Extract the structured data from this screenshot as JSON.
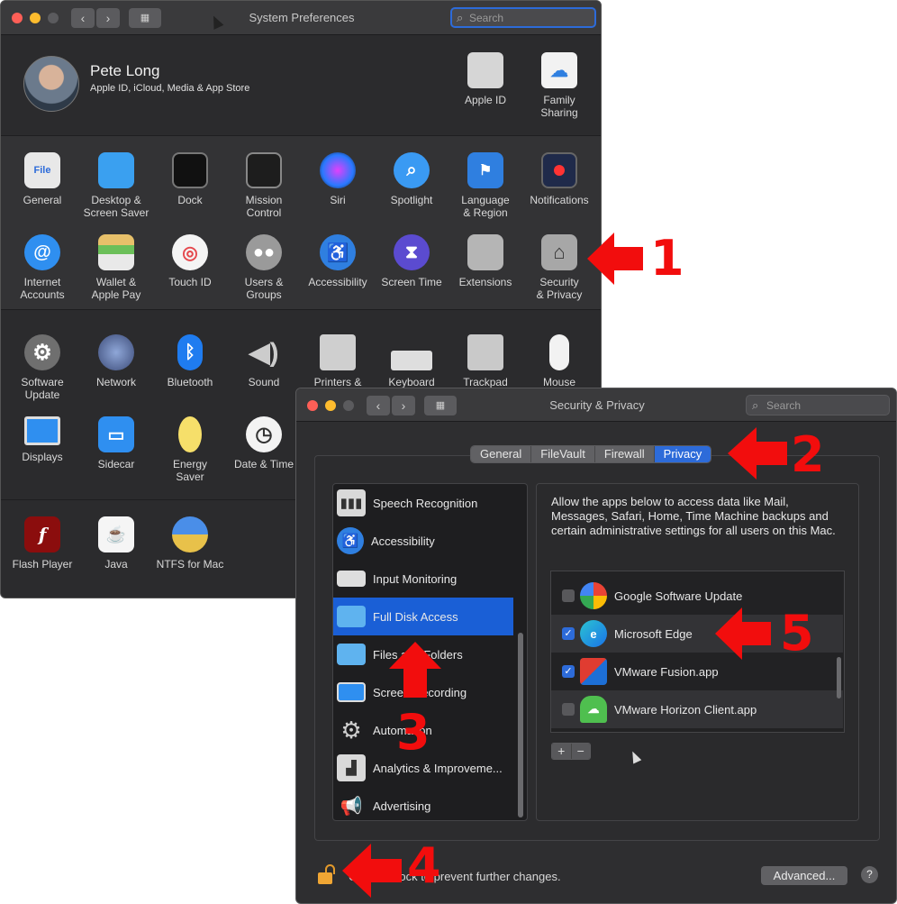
{
  "sysprefs": {
    "title": "System Preferences",
    "search_placeholder": "Search",
    "user": {
      "name": "Pete Long",
      "subtitle": "Apple ID, iCloud, Media & App Store"
    },
    "account_items": [
      {
        "label": "Apple ID",
        "icon": "apple-icon"
      },
      {
        "label": "Family\nSharing",
        "icon": "family-icon"
      }
    ],
    "rows": [
      [
        {
          "label": "General",
          "icon": "general-icon"
        },
        {
          "label": "Desktop &\nScreen Saver",
          "icon": "desktop-icon"
        },
        {
          "label": "Dock",
          "icon": "dock-icon"
        },
        {
          "label": "Mission\nControl",
          "icon": "mission-control-icon"
        },
        {
          "label": "Siri",
          "icon": "siri-icon"
        },
        {
          "label": "Spotlight",
          "icon": "spotlight-icon"
        },
        {
          "label": "Language\n& Region",
          "icon": "flag-icon"
        },
        {
          "label": "Notifications",
          "icon": "notifications-icon"
        }
      ],
      [
        {
          "label": "Internet\nAccounts",
          "icon": "at-icon"
        },
        {
          "label": "Wallet &\nApple Pay",
          "icon": "wallet-icon"
        },
        {
          "label": "Touch ID",
          "icon": "fingerprint-icon"
        },
        {
          "label": "Users &\nGroups",
          "icon": "users-icon"
        },
        {
          "label": "Accessibility",
          "icon": "accessibility-icon"
        },
        {
          "label": "Screen Time",
          "icon": "hourglass-icon"
        },
        {
          "label": "Extensions",
          "icon": "puzzle-icon"
        },
        {
          "label": "Security\n& Privacy",
          "icon": "house-lock-icon"
        }
      ],
      [
        {
          "label": "Software\nUpdate",
          "icon": "gear-icon"
        },
        {
          "label": "Network",
          "icon": "globe-icon"
        },
        {
          "label": "Bluetooth",
          "icon": "bluetooth-icon"
        },
        {
          "label": "Sound",
          "icon": "speaker-icon"
        },
        {
          "label": "Printers &",
          "icon": "printer-icon"
        },
        {
          "label": "Keyboard",
          "icon": "keyboard-icon"
        },
        {
          "label": "Trackpad",
          "icon": "trackpad-icon"
        },
        {
          "label": "Mouse",
          "icon": "mouse-icon"
        }
      ],
      [
        {
          "label": "Displays",
          "icon": "display-icon"
        },
        {
          "label": "Sidecar",
          "icon": "sidecar-icon"
        },
        {
          "label": "Energy\nSaver",
          "icon": "bulb-icon"
        },
        {
          "label": "Date & Time",
          "icon": "clock-icon"
        }
      ],
      [
        {
          "label": "Flash Player",
          "icon": "flash-icon"
        },
        {
          "label": "Java",
          "icon": "java-icon"
        },
        {
          "label": "NTFS for Mac",
          "icon": "ntfs-icon"
        }
      ]
    ]
  },
  "security": {
    "title": "Security & Privacy",
    "search_placeholder": "Search",
    "tabs": [
      "General",
      "FileVault",
      "Firewall",
      "Privacy"
    ],
    "active_tab": "Privacy",
    "categories": [
      {
        "label": "Speech Recognition",
        "icon": "waveform-icon"
      },
      {
        "label": "Accessibility",
        "icon": "accessibility-icon"
      },
      {
        "label": "Input Monitoring",
        "icon": "keyboard-icon"
      },
      {
        "label": "Full Disk Access",
        "icon": "folder-icon",
        "selected": true
      },
      {
        "label": "Files and Folders",
        "icon": "folder-icon"
      },
      {
        "label": "Screen Recording",
        "icon": "display-icon"
      },
      {
        "label": "Automation",
        "icon": "gear-icon"
      },
      {
        "label": "Analytics & Improveme...",
        "icon": "chart-icon"
      },
      {
        "label": "Advertising",
        "icon": "megaphone-icon"
      }
    ],
    "description": "Allow the apps below to access data like Mail, Messages, Safari, Home, Time Machine backups and certain administrative settings for all users on this Mac.",
    "apps": [
      {
        "label": "Google Software Update",
        "checked": false,
        "icon": "google-update-icon"
      },
      {
        "label": "Microsoft Edge",
        "checked": true,
        "icon": "edge-icon"
      },
      {
        "label": "VMware Fusion.app",
        "checked": true,
        "icon": "vmware-icon"
      },
      {
        "label": "VMware Horizon Client.app",
        "checked": false,
        "icon": "horizon-icon"
      }
    ],
    "add_label": "+",
    "remove_label": "−",
    "lock_text": "Click the lock to prevent further changes.",
    "advanced_label": "Advanced...",
    "help_label": "?"
  },
  "annotations": [
    "1",
    "2",
    "3",
    "4",
    "5"
  ]
}
